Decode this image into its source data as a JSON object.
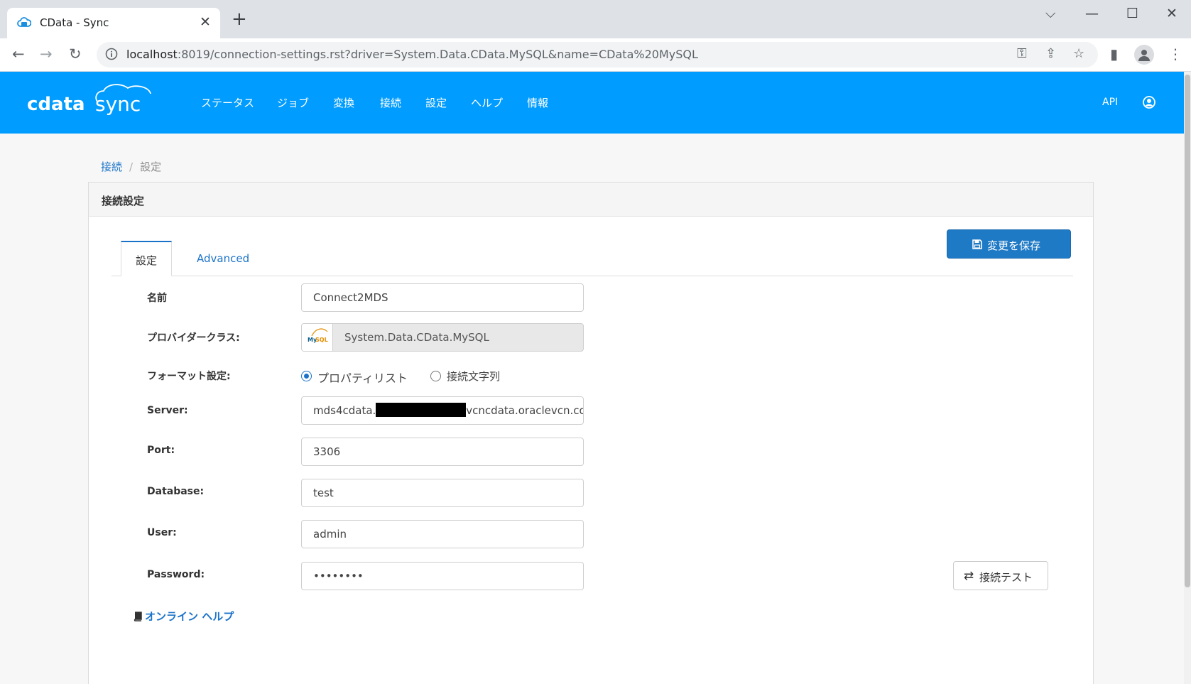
{
  "browser": {
    "tab_title": "CData - Sync",
    "tab_close": "✕",
    "new_tab": "+",
    "url_host": "localhost",
    "url_rest": ":8019/connection-settings.rst?driver=System.Data.CData.MySQL&name=CData%20MySQL",
    "window_controls": {
      "dropdown": "⌵",
      "minimize": "—",
      "maximize": "☐",
      "close": "✕"
    },
    "nav": {
      "back": "←",
      "forward": "→",
      "reload": "↻"
    },
    "toolbar_icons": {
      "key": "⚿",
      "share": "⇪",
      "bookmark": "☆",
      "sidepanel": "▮",
      "menu": "⋮"
    }
  },
  "header": {
    "logo_cdata": "cdata",
    "logo_sync": "sync",
    "nav": [
      "ステータス",
      "ジョブ",
      "変換",
      "接続",
      "設定",
      "ヘルプ",
      "情報"
    ],
    "api_label": "API"
  },
  "breadcrumb": {
    "parent": "接続",
    "separator": "/",
    "current": "設定"
  },
  "card": {
    "title": "接続設定",
    "tabs": [
      {
        "label": "設定",
        "active": true
      },
      {
        "label": "Advanced",
        "active": false
      }
    ],
    "save_button": "変更を保存",
    "fields": {
      "name": {
        "label": "名前",
        "value": "Connect2MDS"
      },
      "provider": {
        "label": "プロバイダークラス:",
        "value": "System.Data.CData.MySQL",
        "logo_my": "My",
        "logo_sql": "SQL"
      },
      "format": {
        "label": "フォーマット設定:",
        "options": [
          "プロパティリスト",
          "接続文字列"
        ],
        "selected": "プロパティリスト"
      },
      "server": {
        "label": "Server:",
        "value_prefix": "mds4cdata.",
        "value_suffix": "vcncdata.oraclevcn.com"
      },
      "port": {
        "label": "Port:",
        "value": "3306"
      },
      "database": {
        "label": "Database:",
        "value": "test"
      },
      "user": {
        "label": "User:",
        "value": "admin"
      },
      "password": {
        "label": "Password:",
        "value": "••••••••"
      }
    },
    "test_button": "接続テスト",
    "test_icon": "⇄",
    "help_link": "オンライン ヘルプ"
  },
  "colors": {
    "header_bg": "#009cff",
    "accent": "#1a73c8",
    "save_bg": "#1f7ac6"
  }
}
